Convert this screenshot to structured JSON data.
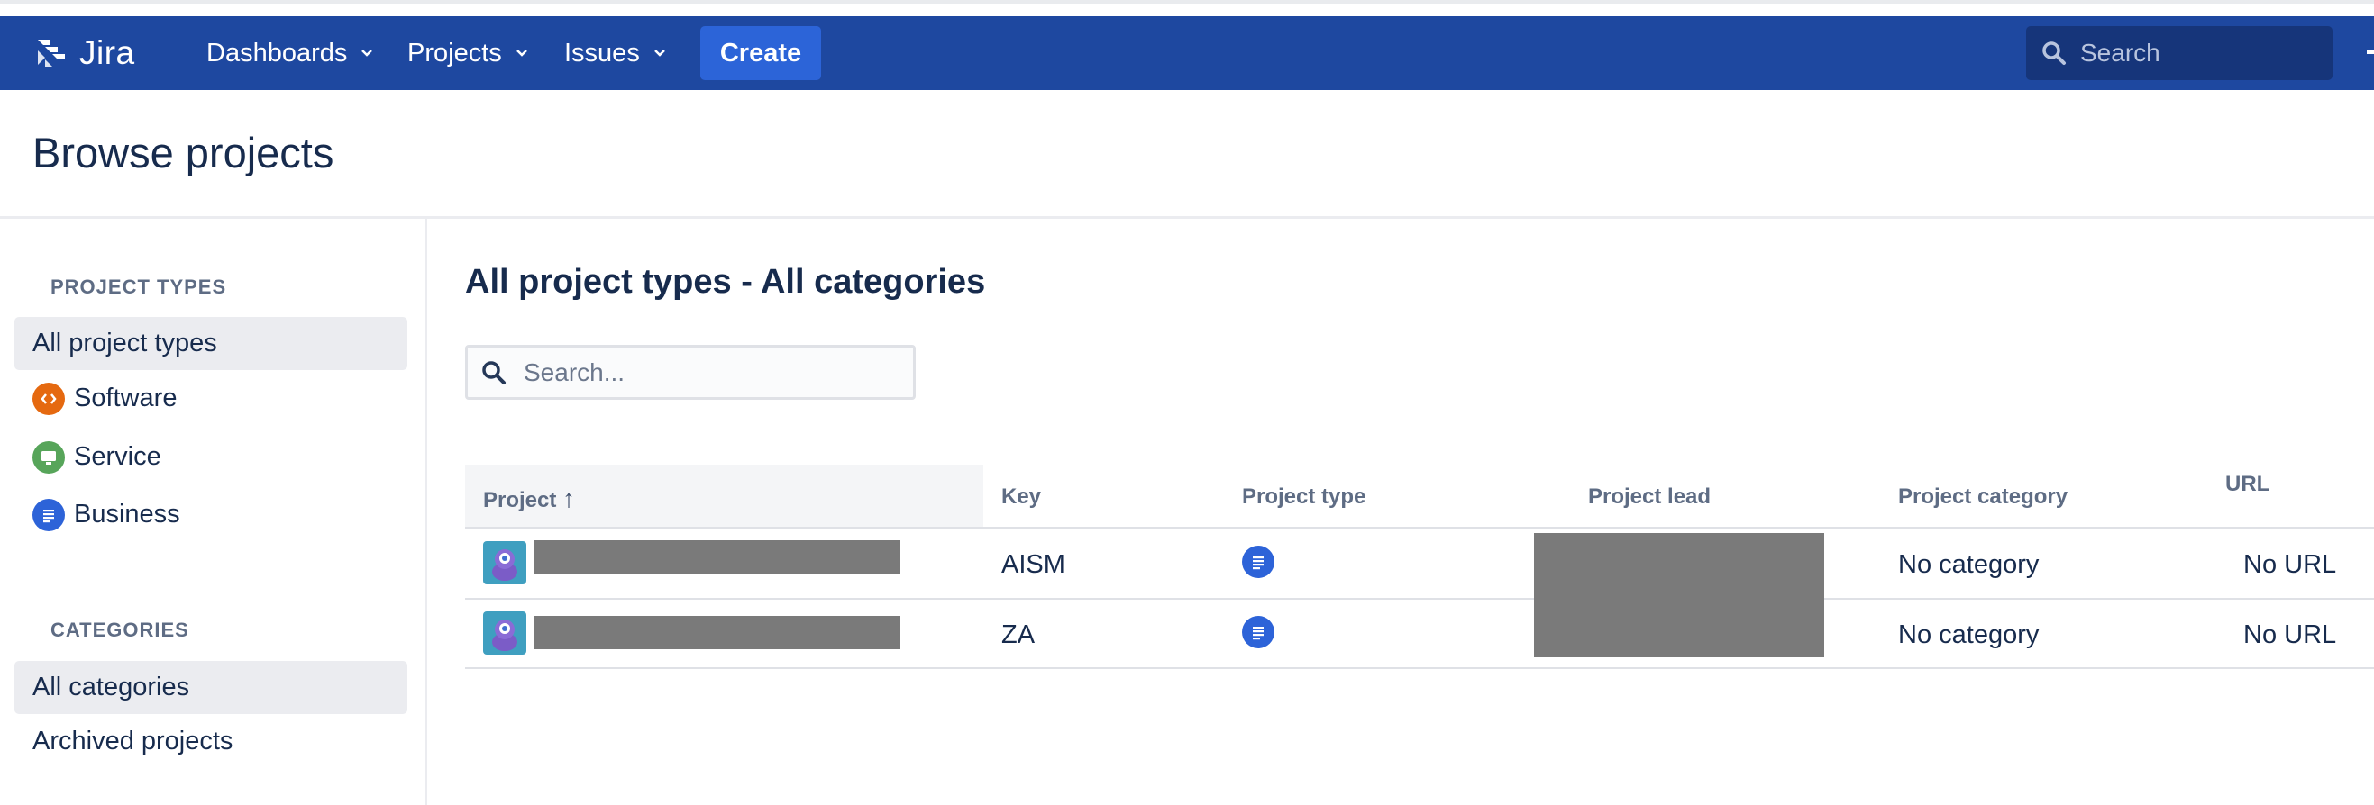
{
  "nav": {
    "logo_text": "Jira",
    "items": [
      {
        "label": "Dashboards"
      },
      {
        "label": "Projects"
      },
      {
        "label": "Issues"
      }
    ],
    "create_label": "Create",
    "search_placeholder": "Search"
  },
  "page": {
    "title": "Browse projects"
  },
  "sidebar": {
    "project_types_heading": "PROJECT TYPES",
    "project_types": [
      {
        "label": "All project types",
        "selected": true
      },
      {
        "label": "Software",
        "icon": "code-icon",
        "color": "#e56910"
      },
      {
        "label": "Service",
        "icon": "monitor-icon",
        "color": "#57a55a"
      },
      {
        "label": "Business",
        "icon": "document-lines-icon",
        "color": "#2d63d8"
      }
    ],
    "categories_heading": "CATEGORIES",
    "categories": [
      {
        "label": "All categories",
        "selected": true
      },
      {
        "label": "Archived projects"
      }
    ]
  },
  "main": {
    "title": "All project types - All categories",
    "search_placeholder": "Search...",
    "table": {
      "columns": [
        "Project",
        "Key",
        "Project type",
        "Project lead",
        "Project category",
        "URL"
      ],
      "sort_indicator": "↑",
      "rows": [
        {
          "key": "AISM",
          "type_icon": "business-icon",
          "category": "No category",
          "url": "No URL"
        },
        {
          "key": "ZA",
          "type_icon": "business-icon",
          "category": "No category",
          "url": "No URL"
        }
      ]
    }
  },
  "colors": {
    "nav_bg": "#1e48a0",
    "create_bg": "#2c64d8",
    "accent": "#2d63d8",
    "text": "#172b4d"
  }
}
